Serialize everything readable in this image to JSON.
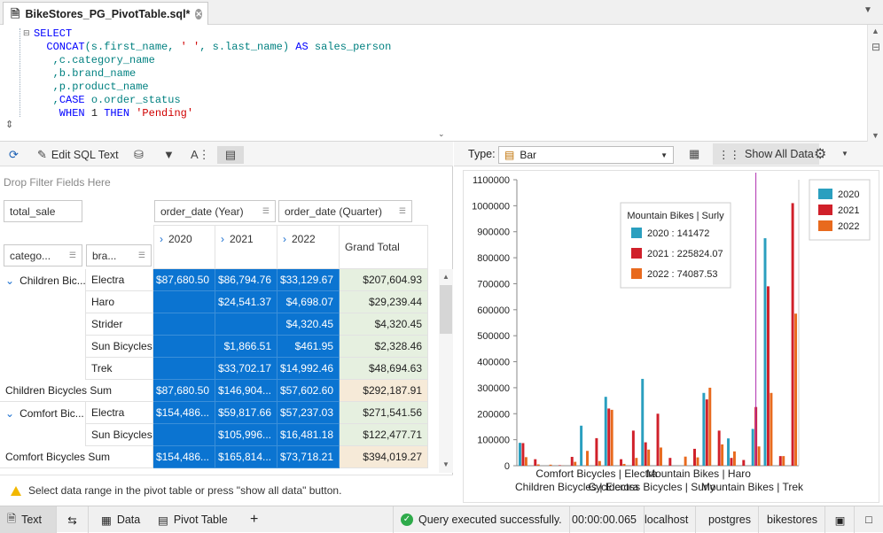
{
  "tab": {
    "title": "BikeStores_PG_PivotTable.sql*"
  },
  "editor": {
    "lines": [
      [
        {
          "t": "SELECT",
          "c": "kw"
        }
      ],
      [
        {
          "t": "  CONCAT",
          "c": "fn"
        },
        {
          "t": "(s.first_name, ",
          "c": "id"
        },
        {
          "t": "' '",
          "c": "str"
        },
        {
          "t": ", s.last_name) ",
          "c": "id"
        },
        {
          "t": "AS",
          "c": "kw"
        },
        {
          "t": " sales_person",
          "c": "id"
        }
      ],
      [
        {
          "t": "   ,c.category_name",
          "c": "id"
        }
      ],
      [
        {
          "t": "   ,b.brand_name",
          "c": "id"
        }
      ],
      [
        {
          "t": "   ,p.product_name",
          "c": "id"
        }
      ],
      [
        {
          "t": "   ,",
          "c": "id"
        },
        {
          "t": "CASE",
          "c": "kw"
        },
        {
          "t": " o.order_status",
          "c": "id"
        }
      ],
      [
        {
          "t": "    WHEN ",
          "c": "kw"
        },
        {
          "t": "1 ",
          "c": "pl"
        },
        {
          "t": "THEN ",
          "c": "kw"
        },
        {
          "t": "'Pending'",
          "c": "str"
        }
      ]
    ]
  },
  "left_toolbar": {
    "edit_sql": "Edit SQL Text"
  },
  "pivot": {
    "drop_filter": "Drop Filter Fields Here",
    "data_field": "total_sale",
    "col_fields": [
      "order_date (Year)",
      "order_date (Quarter)"
    ],
    "row_fields": [
      "catego...",
      "bra..."
    ],
    "years": [
      "2020",
      "2021",
      "2022"
    ],
    "grand_total": "Grand Total",
    "rows": [
      {
        "cat": "Children Bic...",
        "brand": "Electra",
        "v": [
          "$87,680.50",
          "$86,794.76",
          "$33,129.67"
        ],
        "gt": "$207,604.93"
      },
      {
        "cat": "",
        "brand": "Haro",
        "v": [
          "",
          "$24,541.37",
          "$4,698.07"
        ],
        "gt": "$29,239.44"
      },
      {
        "cat": "",
        "brand": "Strider",
        "v": [
          "",
          "",
          "$4,320.45"
        ],
        "gt": "$4,320.45"
      },
      {
        "cat": "",
        "brand": "Sun Bicycles",
        "v": [
          "",
          "$1,866.51",
          "$461.95"
        ],
        "gt": "$2,328.46"
      },
      {
        "cat": "",
        "brand": "Trek",
        "v": [
          "",
          "$33,702.17",
          "$14,992.46"
        ],
        "gt": "$48,694.63"
      },
      {
        "sum": "Children Bicycles Sum",
        "v": [
          "$87,680.50",
          "$146,904...",
          "$57,602.60"
        ],
        "gt": "$292,187.91"
      },
      {
        "cat": "Comfort Bic...",
        "brand": "Electra",
        "v": [
          "$154,486...",
          "$59,817.66",
          "$57,237.03"
        ],
        "gt": "$271,541.56"
      },
      {
        "cat": "",
        "brand": "Sun Bicycles",
        "v": [
          "",
          "$105,996...",
          "$16,481.18"
        ],
        "gt": "$122,477.71"
      },
      {
        "sum": "Comfort Bicycles Sum",
        "v": [
          "$154,486...",
          "$165,814...",
          "$73,718.21"
        ],
        "gt": "$394,019.27"
      }
    ],
    "status": "Select data range in the pivot table or press \"show all data\" button."
  },
  "right_toolbar": {
    "type_label": "Type:",
    "type_value": "Bar",
    "show_all": "Show All Data"
  },
  "chart_data": {
    "type": "bar",
    "ylim": [
      0,
      1100000
    ],
    "yticks": [
      "0",
      "100000",
      "200000",
      "300000",
      "400000",
      "500000",
      "600000",
      "700000",
      "800000",
      "900000",
      "1000000",
      "1100000"
    ],
    "x_labels_row1": [
      "Comfort Bicycles | Electra",
      "Mountain Bikes | Haro"
    ],
    "x_labels_row2": [
      "Children Bicycles | Electra",
      "Cyclocross Bicycles | Surly",
      "Mountain Bikes | Trek"
    ],
    "legend": [
      "2020",
      "2021",
      "2022"
    ],
    "colors": [
      "#2a9fbf",
      "#d0202a",
      "#e86a1e"
    ],
    "series": [
      {
        "name": "2020",
        "values": [
          88000,
          0,
          0,
          0,
          0,
          154000,
          0,
          265000,
          0,
          0,
          334000,
          0,
          0,
          0,
          0,
          280000,
          0,
          105000,
          0,
          141472,
          875000,
          0,
          0
        ]
      },
      {
        "name": "2021",
        "values": [
          87000,
          25000,
          0,
          2000,
          34000,
          0,
          106000,
          220000,
          25000,
          135000,
          90000,
          200000,
          30000,
          0,
          65000,
          255000,
          135000,
          30000,
          22000,
          225824,
          690000,
          37000,
          1010000
        ]
      },
      {
        "name": "2022",
        "values": [
          33000,
          5000,
          4000,
          500,
          15000,
          57000,
          18000,
          215000,
          7000,
          30000,
          62000,
          70000,
          0,
          35000,
          32000,
          300000,
          82000,
          55000,
          0,
          74088,
          280000,
          37000,
          585000
        ]
      }
    ],
    "tooltip": {
      "title": "Mountain Bikes | Surly",
      "lines": [
        "2020 : 141472",
        "2021 : 225824.07",
        "2022 : 74087.53"
      ]
    }
  },
  "bottom": {
    "text_tab": "Text",
    "data_tab": "Data",
    "pivot_tab": "Pivot Table",
    "status": "Query executed successfully.",
    "time": "00:00:00.065",
    "host": "localhost",
    "user": "postgres",
    "db": "bikestores"
  }
}
